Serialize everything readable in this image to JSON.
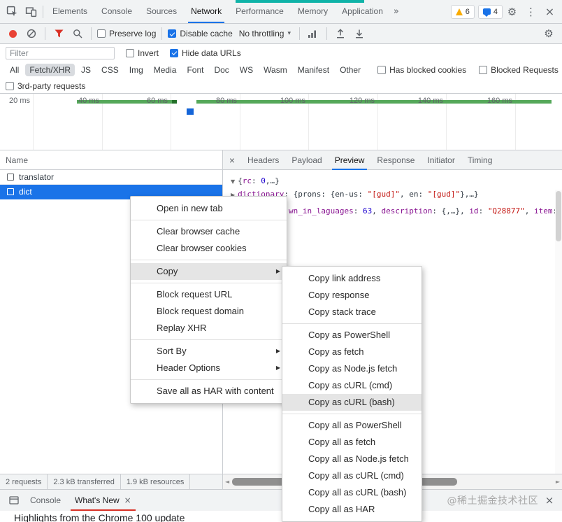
{
  "icons": {
    "gear": "⚙",
    "kebab": "⋮",
    "close": "×",
    "caret": "▾",
    "submenu": "▶",
    "expanded": "▼",
    "collapsed": "▶",
    "scroll_left": "◄",
    "scroll_right": "►"
  },
  "tabbar": {
    "tabs": [
      "Elements",
      "Console",
      "Sources",
      "Network",
      "Performance",
      "Memory",
      "Application"
    ],
    "active": "Network",
    "overflow": "»",
    "warning_count": "6",
    "message_count": "4"
  },
  "toolbar": {
    "preserve_log": "Preserve log",
    "disable_cache": "Disable cache",
    "throttling": "No throttling"
  },
  "filterbar": {
    "placeholder": "Filter",
    "invert": "Invert",
    "hide_data_urls": "Hide data URLs",
    "chips": [
      "All",
      "Fetch/XHR",
      "JS",
      "CSS",
      "Img",
      "Media",
      "Font",
      "Doc",
      "WS",
      "Wasm",
      "Manifest",
      "Other"
    ],
    "selected_chip": "Fetch/XHR",
    "has_blocked_cookies": "Has blocked cookies",
    "blocked_requests": "Blocked Requests",
    "third_party": "3rd-party requests"
  },
  "timeline": {
    "labels": [
      "20 ms",
      "40 ms",
      "60 ms",
      "80 ms",
      "100 ms",
      "120 ms",
      "140 ms",
      "160 ms"
    ]
  },
  "table": {
    "name_header": "Name",
    "rows": [
      {
        "name": "translator"
      },
      {
        "name": "dict"
      }
    ],
    "selected_row": "dict"
  },
  "details": {
    "tabs": [
      "Headers",
      "Payload",
      "Preview",
      "Response",
      "Initiator",
      "Timing"
    ],
    "active_tab": "Preview",
    "preview": {
      "root_open": "{",
      "root_key": "rc",
      "root_colon": ": ",
      "root_value": "0",
      "root_rest": ",…}",
      "dict_key": "dictionary",
      "dict_colon": ": ",
      "dict_p1": "{prons: {en-us: ",
      "dict_s1": "\"[gud]\"",
      "dict_p2": ", en: ",
      "dict_s2": "\"[gud]\"",
      "dict_p3": "},…}",
      "l3_k1": "wn_in_laguages",
      "l3_c1": ": ",
      "l3_n1": "63",
      "l3_p1": ", ",
      "l3_k2": "description",
      "l3_c2": ": {,…}, ",
      "l3_k3": "id",
      "l3_c3": ": ",
      "l3_s1": "\"Q28877\"",
      "l3_p2": ", ",
      "l3_k4": "item",
      "l3_c4": ": "
    }
  },
  "menu1": {
    "items": [
      "Open in new tab",
      "Clear browser cache",
      "Clear browser cookies",
      "Copy",
      "Block request URL",
      "Block request domain",
      "Replay XHR",
      "Sort By",
      "Header Options",
      "Save all as HAR with content"
    ],
    "highlighted": "Copy"
  },
  "menu2": {
    "items": [
      "Copy link address",
      "Copy response",
      "Copy stack trace",
      "Copy as PowerShell",
      "Copy as fetch",
      "Copy as Node.js fetch",
      "Copy as cURL (cmd)",
      "Copy as cURL (bash)",
      "Copy all as PowerShell",
      "Copy all as fetch",
      "Copy all as Node.js fetch",
      "Copy all as cURL (cmd)",
      "Copy all as cURL (bash)",
      "Copy all as HAR"
    ],
    "highlighted": "Copy as cURL (bash)"
  },
  "statusbar": {
    "requests": "2 requests",
    "transferred": "2.3 kB transferred",
    "resources": "1.9 kB resources"
  },
  "drawer": {
    "console_tab": "Console",
    "whatsnew_tab": "What's New",
    "watermark": "@稀土掘金技术社区",
    "heading": "Highlights from the Chrome 100 update"
  }
}
